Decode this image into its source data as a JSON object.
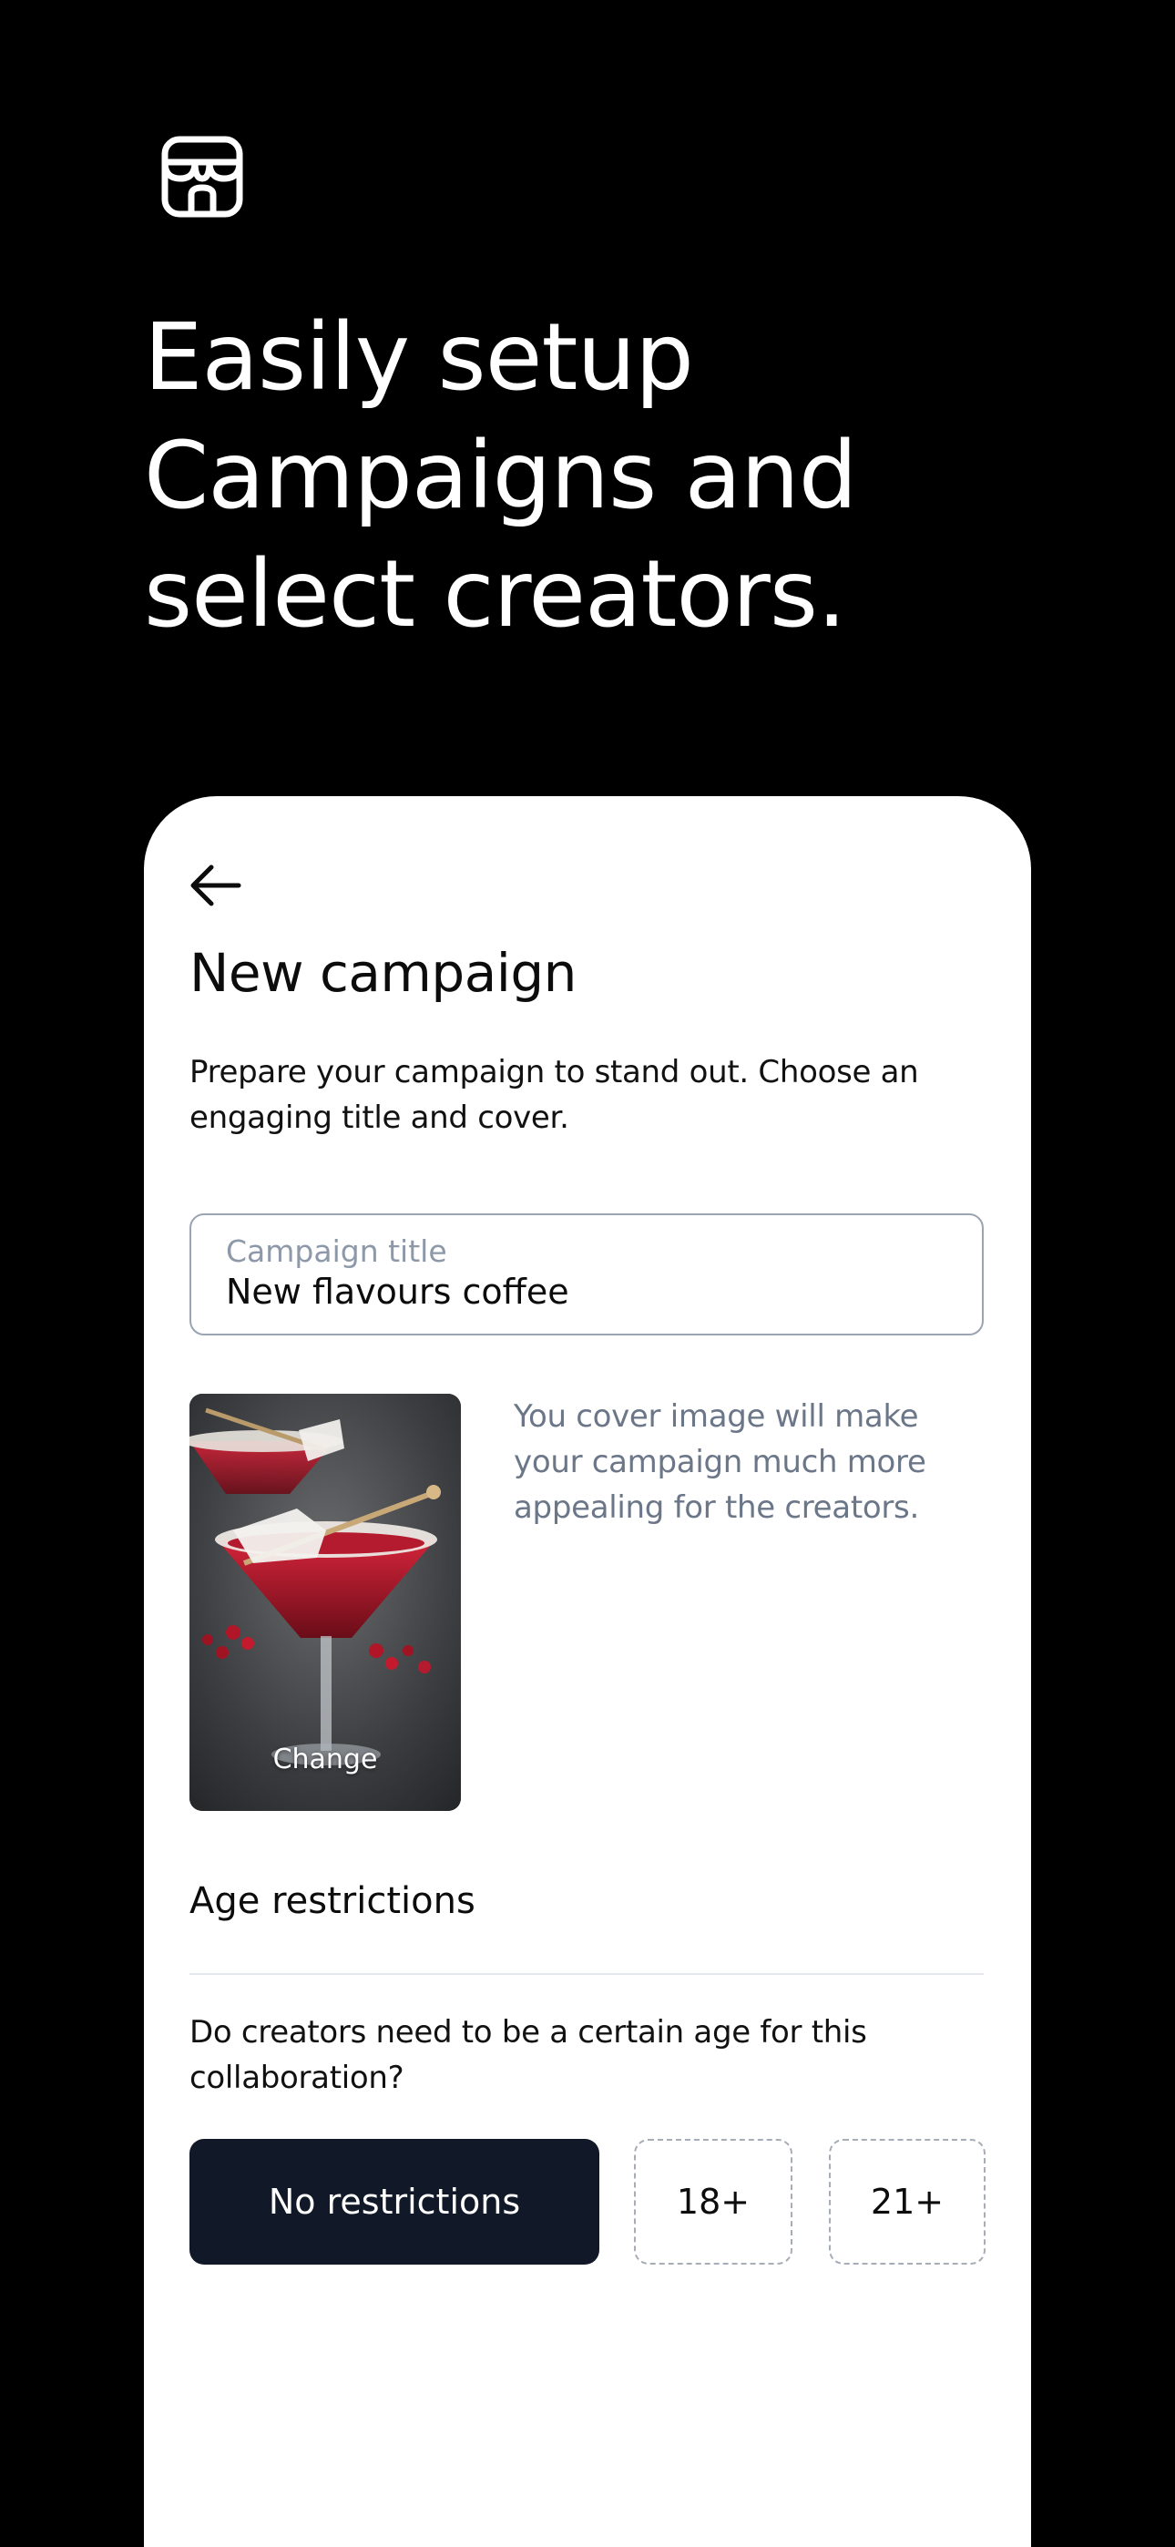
{
  "headline": {
    "lines": [
      "Easily setup",
      "Campaigns and",
      "select creators."
    ]
  },
  "icons": {
    "store": "store-icon",
    "back": "arrow-left-icon"
  },
  "campaign": {
    "title": "New campaign",
    "description": "Prepare your campaign to stand out. Choose an engaging title and cover.",
    "title_field": {
      "label": "Campaign title",
      "value": "New flavours coffee"
    },
    "cover": {
      "change_label": "Change",
      "hint": "You cover image will make your campaign much more appealing for the creators."
    }
  },
  "age": {
    "section_title": "Age restrictions",
    "question": "Do creators need to be a certain age for this collaboration?",
    "options": [
      {
        "label": "No restrictions",
        "selected": true
      },
      {
        "label": "18+",
        "selected": false
      },
      {
        "label": "21+",
        "selected": false
      }
    ]
  },
  "colors": {
    "background": "#000000",
    "card": "#ffffff",
    "selected_option": "#111827",
    "muted_text": "#6b7789",
    "field_border": "#9aa4b2"
  }
}
